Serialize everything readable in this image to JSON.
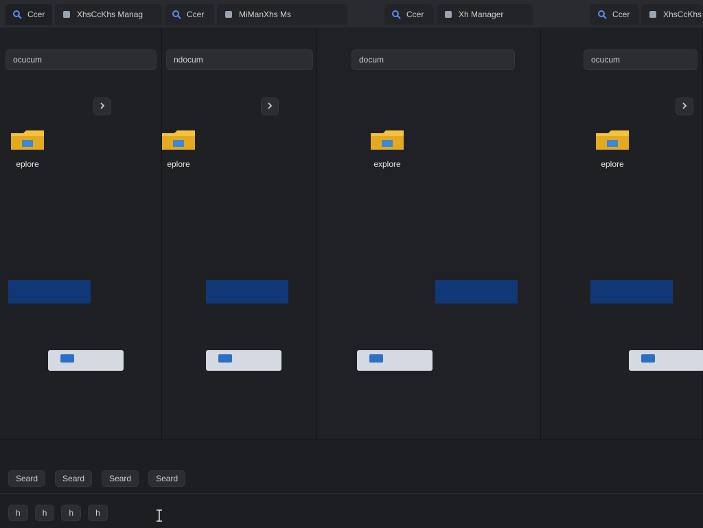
{
  "topbar": {
    "tabs": [
      {
        "label": "Ccer",
        "icon": "search-icon"
      },
      {
        "label": "XhsCcKhs Manag",
        "icon": "app-icon"
      },
      {
        "label": "Ccer",
        "icon": "search-icon"
      },
      {
        "label": "MiManXhs Ms",
        "icon": "app-icon"
      },
      {
        "label": "Ccer",
        "icon": "search-icon"
      },
      {
        "label": "Xh Manager",
        "icon": "app-icon"
      },
      {
        "label": "Ccer",
        "icon": "search-icon"
      },
      {
        "label": "XhsCcKhs Manager",
        "icon": "app-icon"
      }
    ]
  },
  "panes": [
    {
      "address": "ocucum",
      "folder_label": "eplore"
    },
    {
      "address": "ndocum",
      "folder_label": "eplore"
    },
    {
      "address": "docum",
      "folder_label": "explore"
    },
    {
      "address": "ocucum",
      "folder_label": "eplore"
    }
  ],
  "bottom": {
    "search_label": "Seard",
    "pills": [
      "Seard",
      "Seard",
      "Seard",
      "Seard"
    ],
    "footer": [
      "h",
      "h",
      "h",
      "h"
    ]
  },
  "colors": {
    "background": "#1e1f22",
    "topbar": "#2a2b2f",
    "accent_blue": "#0e3f8b",
    "folder_yellow": "#f4c23d"
  }
}
